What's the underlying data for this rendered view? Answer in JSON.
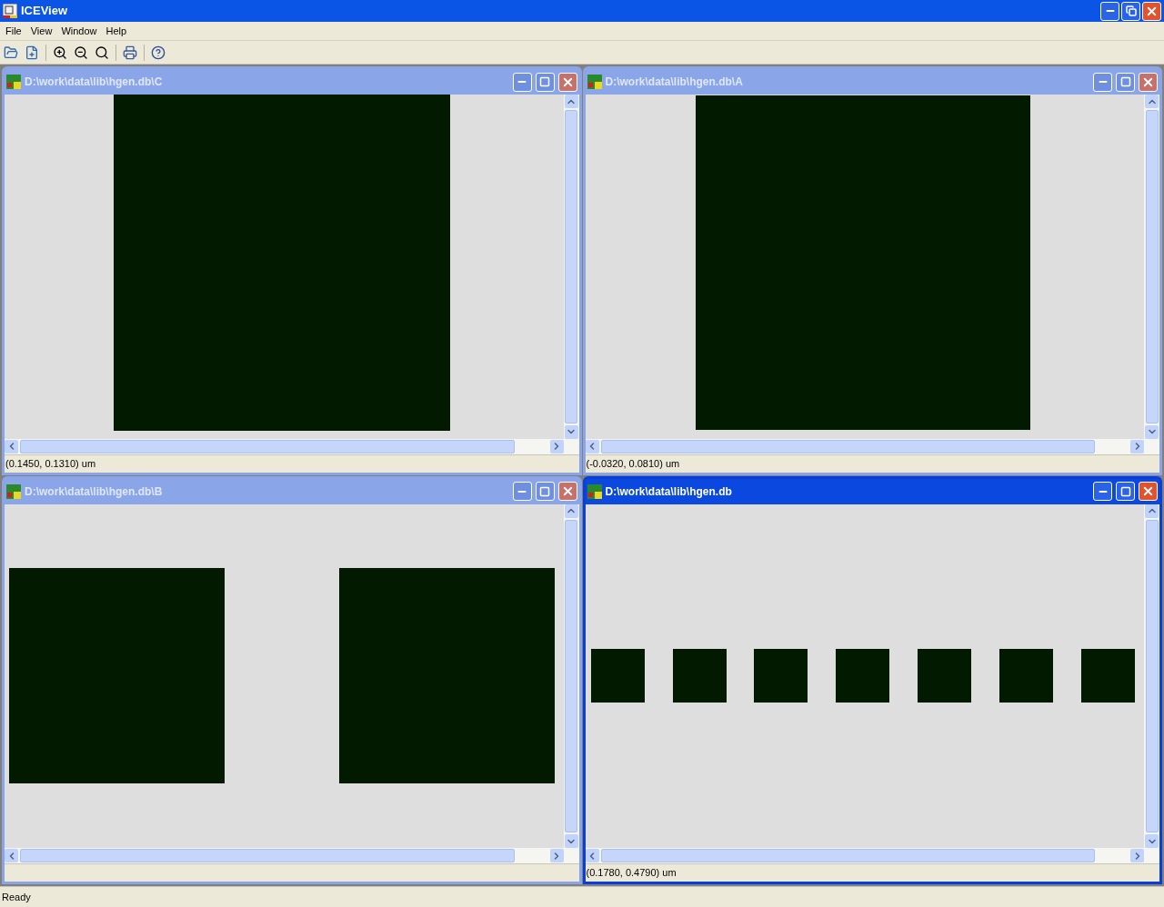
{
  "window": {
    "title": "ICEView"
  },
  "menu": [
    "File",
    "View",
    "Window",
    "Help"
  ],
  "children": [
    {
      "title": "D:\\work\\data\\lib\\hgen.db\\C",
      "status": "(0.1450, 0.1310) um",
      "active": false
    },
    {
      "title": "D:\\work\\data\\lib\\hgen.db\\A",
      "status": "(-0.0320, 0.0810) um",
      "active": false
    },
    {
      "title": "D:\\work\\data\\lib\\hgen.db\\B",
      "active": false
    },
    {
      "title": "D:\\work\\data\\lib\\hgen.db",
      "status": "(0.1780, 0.4790) um",
      "active": true
    }
  ],
  "status_bar": "Ready"
}
